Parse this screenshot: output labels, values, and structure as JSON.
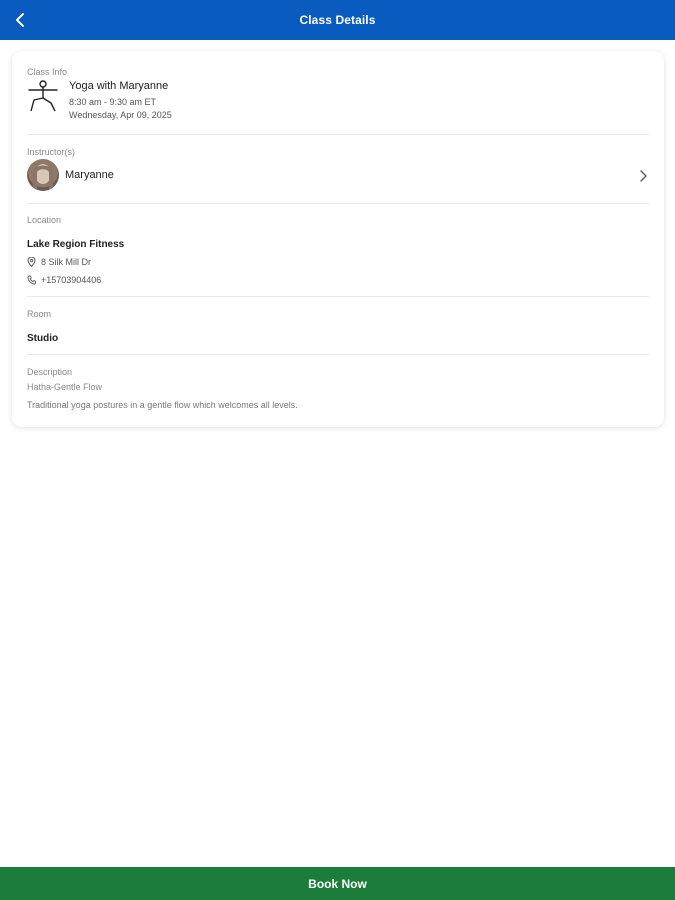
{
  "header": {
    "title": "Class Details"
  },
  "class_info": {
    "label": "Class Info",
    "name": "Yoga with Maryanne",
    "time": "8:30 am - 9:30 am ET",
    "date": "Wednesday, Apr 09, 2025"
  },
  "instructor": {
    "label": "Instructor(s)",
    "name": "Maryanne"
  },
  "location": {
    "label": "Location",
    "name": "Lake Region Fitness",
    "address": "8 Silk Mill Dr",
    "phone": "+15703904406"
  },
  "room": {
    "label": "Room",
    "name": "Studio"
  },
  "description": {
    "label": "Description",
    "subtitle": "Hatha-Gentle Flow",
    "text": "Traditional yoga postures in a gentle flow which welcomes all levels."
  },
  "footer": {
    "book_label": "Book Now"
  },
  "colors": {
    "header_bg": "#0a5bbf",
    "book_bg": "#1c7d3b"
  },
  "icons": {
    "back": "chevron-left-icon",
    "class": "yoga-pose-icon",
    "instructor_more": "chevron-right-icon",
    "address": "map-pin-icon",
    "phone": "phone-icon"
  }
}
